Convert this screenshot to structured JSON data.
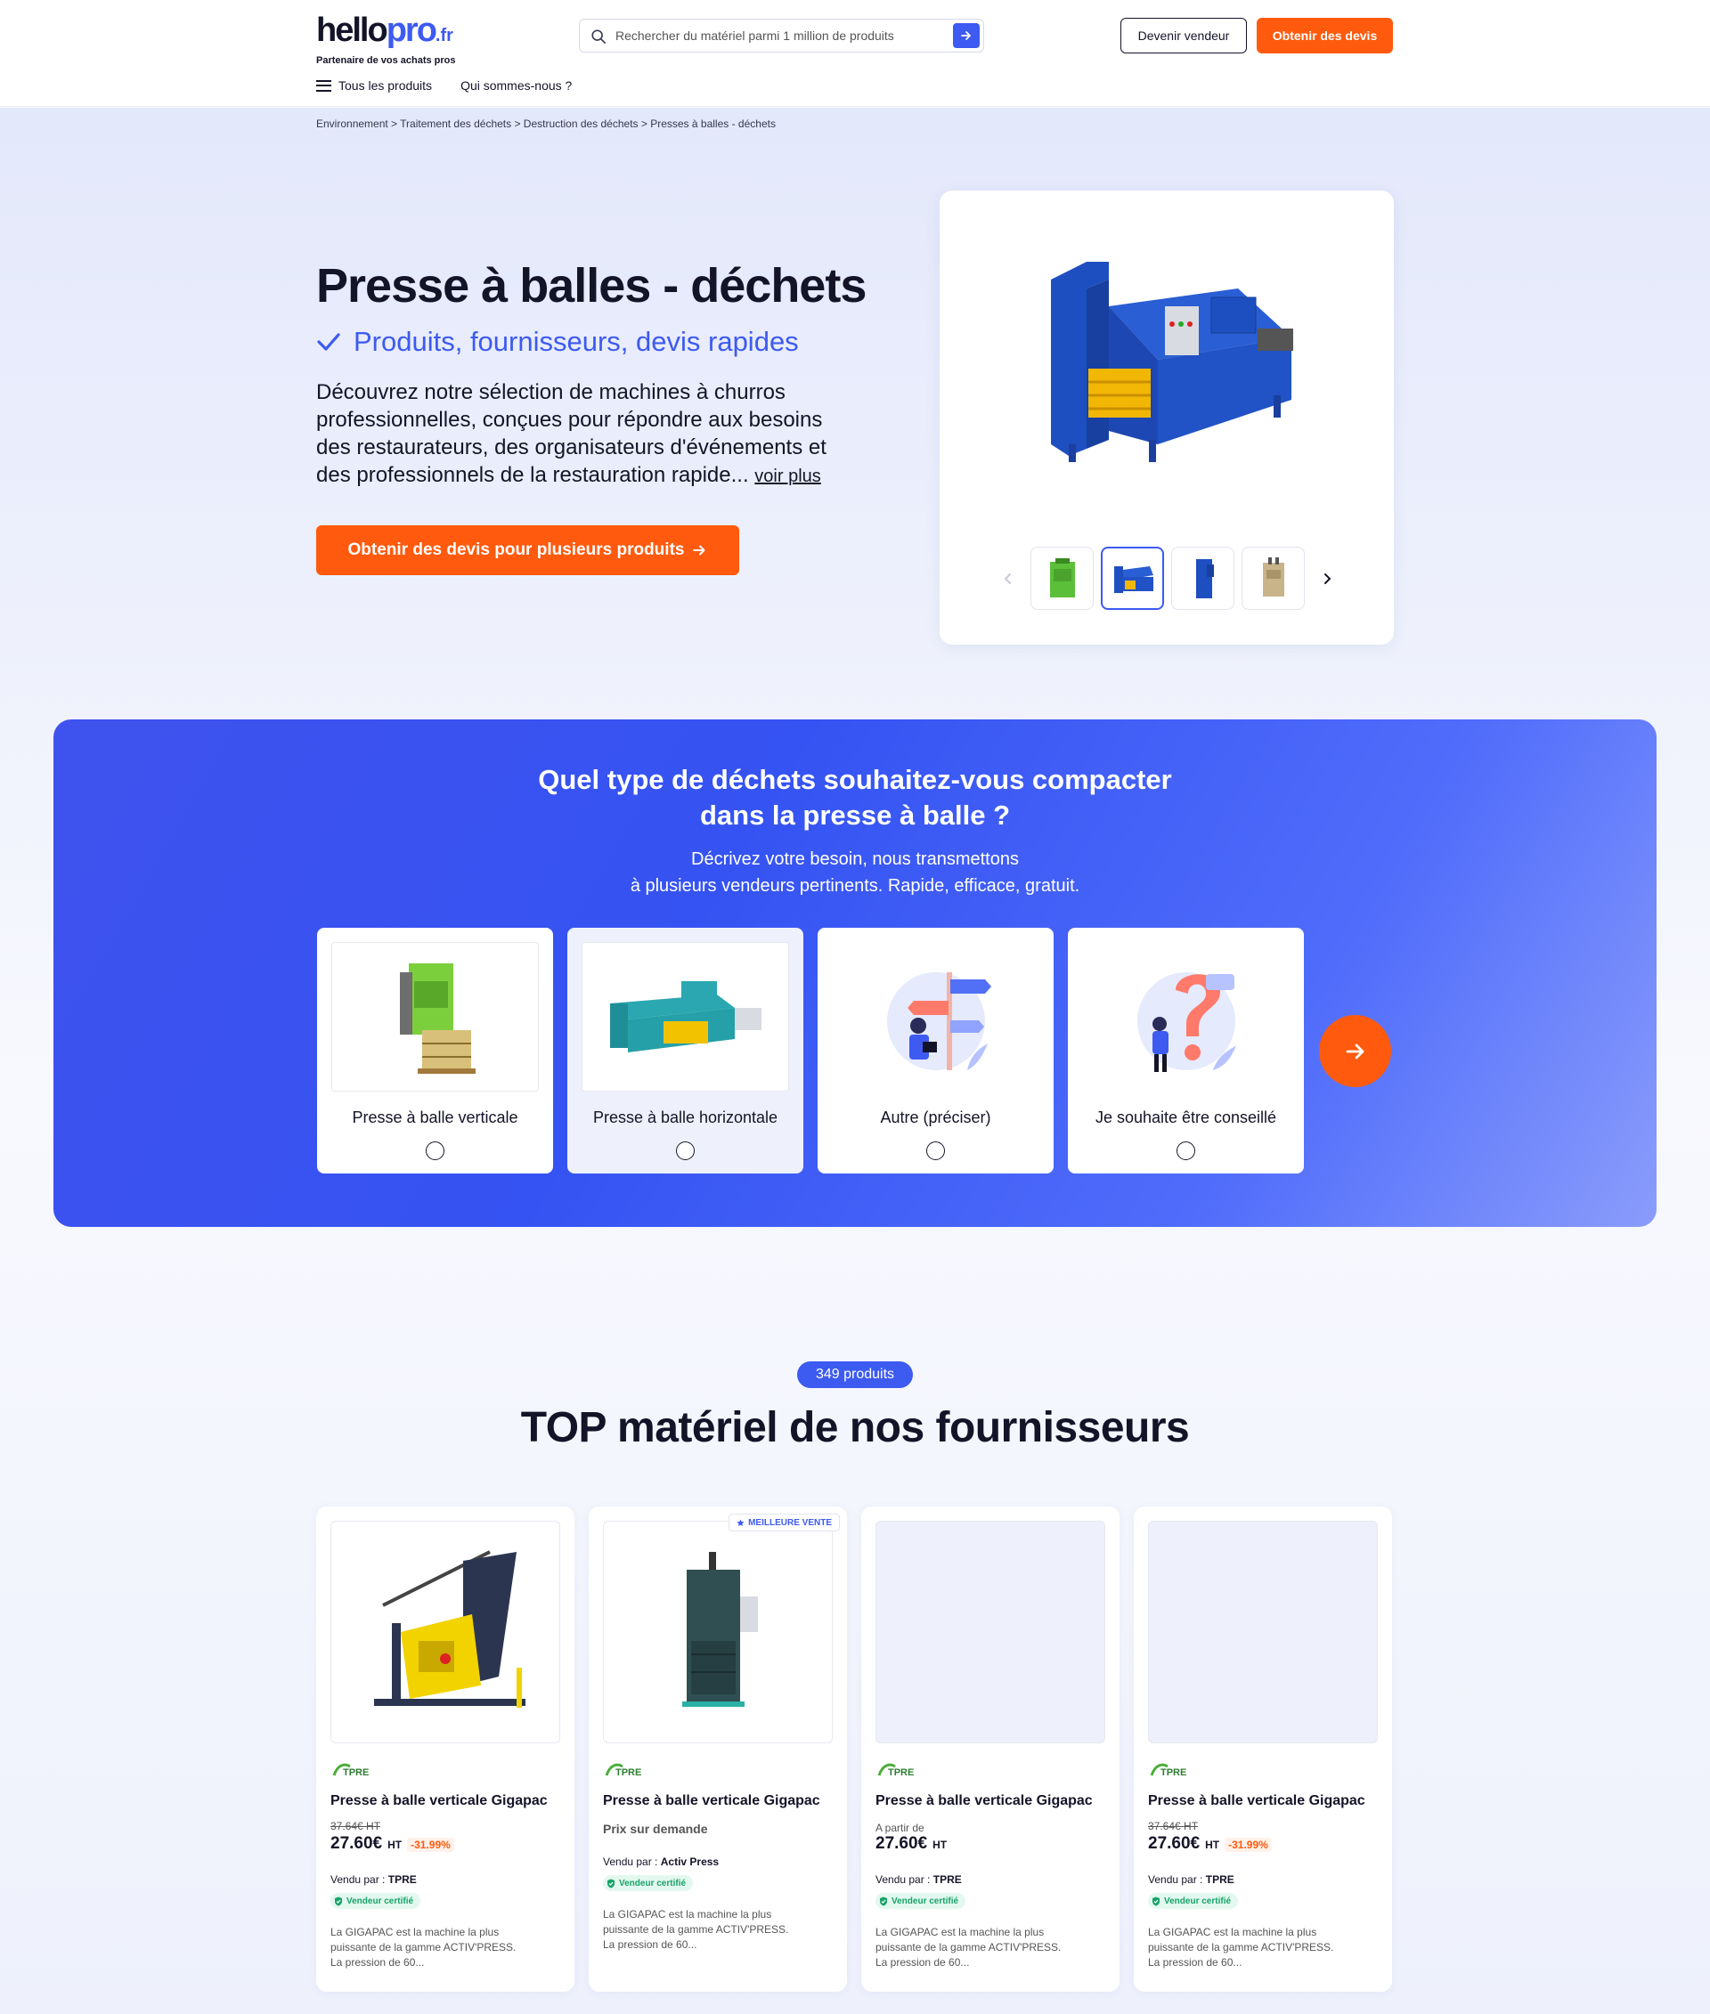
{
  "header": {
    "logo_hello": "hello",
    "logo_pro": "pro",
    "logo_fr": ".fr",
    "tagline": "Partenaire de vos achats pros",
    "search_placeholder": "Rechercher du matériel parmi 1 million de produits",
    "vendor_button": "Devenir vendeur",
    "quote_button": "Obtenir des devis",
    "nav": [
      "Tous les produits",
      "Qui sommes-nous ?"
    ]
  },
  "breadcrumb": "Environnement > Traitement des déchets > Destruction des déchets > Presses à balles - déchets",
  "hero": {
    "title": "Presse à balles - déchets",
    "subtitle": "Produits, fournisseurs, devis rapides",
    "description": "Découvrez notre sélection de machines à churros professionnelles, conçues pour répondre aux besoins des restaurateurs, des organisateurs d'événements et des professionnels de la restauration rapide...",
    "read_more": "voir plus",
    "cta": "Obtenir des devis pour plusieurs produits",
    "gallery_selected_index": 1,
    "gallery_thumb_count": 4
  },
  "banner": {
    "title_line1": "Quel type de déchets souhaitez-vous compacter",
    "title_line2": "dans la presse à balle ?",
    "sub_line1": "Décrivez votre besoin, nous transmettons",
    "sub_line2": "à plusieurs vendeurs pertinents. Rapide, efficace, gratuit.",
    "options": [
      {
        "label": "Presse à balle verticale"
      },
      {
        "label": "Presse à balle horizontale"
      },
      {
        "label": "Autre (préciser)"
      },
      {
        "label": "Je souhaite être conseillé"
      }
    ]
  },
  "products": {
    "count_badge": "349 produits",
    "title": "TOP matériel de nos fournisseurs",
    "best_seller_label": "MEILLEURE VENTE",
    "items": [
      {
        "name": "Presse à balle verticale Gigapac",
        "old_price": "37.64€ HT",
        "price": "27.60€",
        "ht": "HT",
        "discount": "-31.99%",
        "seller_label": "Vendu par :",
        "seller": "TPRE",
        "certified": "Vendeur certifié",
        "description_lines": [
          "La GIGAPAC est la machine la plus",
          "puissante de la gamme ACTIV'PRESS.",
          "La pression de 60..."
        ]
      },
      {
        "name": "Presse à balle verticale Gigapac",
        "on_demand": "Prix sur demande",
        "seller_label": "Vendu par :",
        "seller": "Activ Press",
        "certified": "Vendeur certifié",
        "description_lines": [
          "La GIGAPAC est la machine la plus",
          "puissante de la gamme ACTIV'PRESS.",
          "La pression de 60..."
        ]
      },
      {
        "name": "Presse à balle verticale Gigapac",
        "from_label": "A partir de",
        "price": "27.60€",
        "ht": "HT",
        "seller_label": "Vendu par :",
        "seller": "TPRE",
        "certified": "Vendeur certifié",
        "description_lines": [
          "La GIGAPAC est la machine la plus",
          "puissante de la gamme ACTIV'PRESS.",
          "La pression de 60..."
        ]
      },
      {
        "name": "Presse à balle verticale Gigapac",
        "old_price": "37.64€ HT",
        "price": "27.60€",
        "ht": "HT",
        "discount": "-31.99%",
        "seller_label": "Vendu par :",
        "seller": "TPRE",
        "certified": "Vendeur certifié",
        "description_lines": [
          "La GIGAPAC est la machine la plus",
          "puissante de la gamme ACTIV'PRESS.",
          "La pression de 60..."
        ]
      }
    ]
  },
  "colors": {
    "brand_blue": "#3d5af1",
    "brand_orange": "#ff5a0d",
    "text_dark": "#141428",
    "certified_green": "#18a36a"
  },
  "icons": [
    "search-icon",
    "arrow-right-icon",
    "hamburger-icon",
    "check-icon",
    "chevron-left-icon",
    "chevron-right-icon",
    "star-icon",
    "shield-check-icon"
  ]
}
